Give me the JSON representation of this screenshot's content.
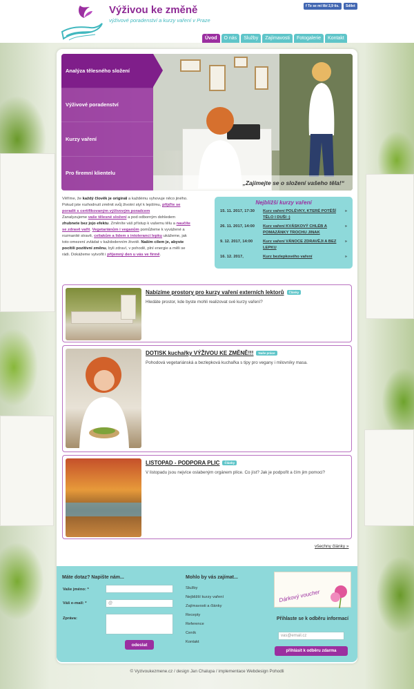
{
  "header": {
    "title": "Výživou ke změně",
    "subtitle": "výživové poradenství a kurzy vaření v Praze",
    "fb_like": "To se mi líbí 2,9 tis.",
    "fb_share": "Sdílet"
  },
  "nav": {
    "items": [
      "Úvod",
      "O nás",
      "Služby",
      "Zajímavosti",
      "Fotogalerie",
      "Kontakt"
    ],
    "active": "Úvod"
  },
  "hero": {
    "menu": [
      "Analýza tělesného složení",
      "Výživové poradenství",
      "Kurzy vaření",
      "Pro firemní klientelu"
    ],
    "caption": "„Zajímejte se o složení vašeho těla!“"
  },
  "intro": {
    "p1_a": "Věříme, že ",
    "p1_b": "každý člověk je originál",
    "p1_c": " a každému vyhovuje něco jiného.",
    "p2_a": "Pokud jste rozhodnutí změnit svůj životní styl k lepšímu, ",
    "p2_link": "přijďte se poradit s certifikovaným výživovým poradcem",
    "p3_a": "Zanalyzujeme ",
    "p3_link": "vaše tělesné složení",
    "p3_b": " a pod odborným dohledem ",
    "p3_bold": "zhubnete bez jojo efektu",
    "p3_c": ". Změníte váš přístup k vašemu tělu a ",
    "p3_link2": "naučíte se zdravě vařit",
    "p3_d": ". ",
    "p3_link3": "Vegetariánům i veganům",
    "p3_e": " pomůžeme k vyvážené a rozmanité stravě, ",
    "p3_link4": "celiakům a lidem s intolerancí lepku",
    "p3_f": " ukážeme, jak toto omezení zvládat v každodenním životě. ",
    "p3_bold2": "Naším cílem je, abyste pocítili pozitivní změnu",
    "p3_g": ", byli zdraví, v pohodě, plní energie a měli se rádi. Dokážeme vytvořit i ",
    "p3_link5": "příjemný den u vás ve firmě",
    "p3_h": "."
  },
  "courses": {
    "heading": "Nejbližší kurzy vaření",
    "rows": [
      {
        "date": "15. 11. 2017, 17:30",
        "name": "Kurz vaření POLÉVKY, KTERÉ POTĚŠÍ TĚLO I DUŠI :)"
      },
      {
        "date": "26. 11. 2017, 14:00",
        "name": "Kurz vaření KVÁSKOVÝ CHLÉB A POMAZÁNKY TROCHU JINAK"
      },
      {
        "date": "9. 12. 2017, 14:00",
        "name": "Kurz vaření VÁNOCE ZDRAVĚJI A BEZ LEPKU"
      },
      {
        "date": "16. 12. 2017,",
        "name": "Kurz bezlepkového vaření"
      }
    ],
    "arrow": "»"
  },
  "articles": [
    {
      "title": "Nabízíme prostory pro kurzy vaření externích lektorů",
      "badge": "Články",
      "desc": "Hledáte prostor, kde byste mohli realizovat své kurzy vaření?"
    },
    {
      "title": "DOTISK kuchařky VÝŽIVOU KE ZMĚNĚ!!!",
      "badge": "Naše práce",
      "desc": "Pohodová vegetariánská a bezlepková kuchařka s tipy pro vegany i milovníky masa."
    },
    {
      "title": "LISTOPAD - PODPORA PLIC",
      "badge": "Články",
      "desc": "V listopadu jsou nejvíce oslabeným orgánem plíce. Co jíst? Jak je podpořit a čím jim pomoci?"
    }
  ],
  "all_articles": "všechny články »",
  "contact": {
    "heading": "Máte dotaz? Napište nám...",
    "name_label": "Vaše jméno: *",
    "email_label": "Váš e-mail: *",
    "email_value": "@",
    "message_label": "Zpráva:",
    "submit": "odeslat"
  },
  "links": {
    "heading": "Mohlo by vás zajímat...",
    "items": [
      "Služby",
      "Nejbližší kurzy vaření",
      "Zajímavosti a články",
      "Recepty",
      "Reference",
      "Ceník",
      "Kontakt"
    ]
  },
  "newsletter": {
    "voucher_text": "Dárkový voucher",
    "heading": "Přihlaste se k odběru informací",
    "placeholder": "vas@email.cz",
    "button": "přihlásit k odběru zdarma"
  },
  "copyright": "© Vyzivoukezmene.cz / design Jan Chalupa / implementace Webdesign Pohodli",
  "colors": {
    "purple": "#9b2fa0",
    "teal": "#5fc5c9",
    "light_teal": "#8ed9da"
  }
}
